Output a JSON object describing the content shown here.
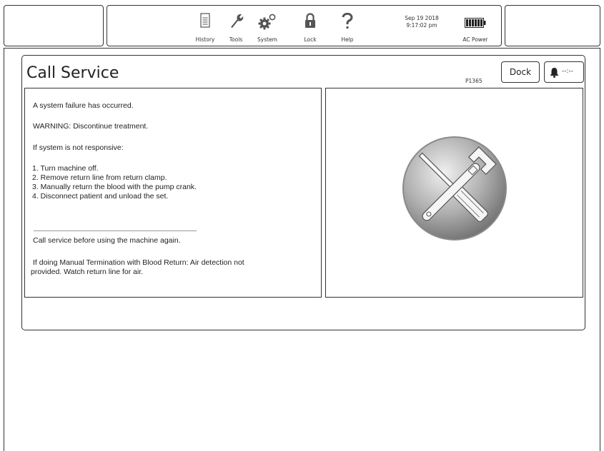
{
  "topbar": {
    "nav": [
      {
        "label": "History",
        "icon": "document-icon"
      },
      {
        "label": "Tools",
        "icon": "wrench-icon"
      },
      {
        "label": "System",
        "icon": "gears-icon"
      },
      {
        "label": "Lock",
        "icon": "padlock-icon"
      },
      {
        "label": "Help",
        "icon": "question-icon"
      }
    ],
    "date": "Sep 19 2018",
    "time": "9:17:02 pm",
    "power": "AC Power"
  },
  "panel": {
    "title": "Call Service",
    "code": "P1365",
    "dock_label": "Dock",
    "alarm_time": "--:--",
    "message": {
      "line1": "A system failure has occurred.",
      "line2": "WARNING: Discontinue treatment.",
      "line3": "If system is not responsive:",
      "steps": [
        "1.  Turn machine off.",
        "2.  Remove return line from return clamp.",
        "3.  Manually return the blood with the pump crank.",
        "4.  Disconnect patient and unload the set."
      ],
      "after1": "Call service before using the machine again.",
      "after2a": "If doing Manual Termination with Blood Return: Air detection not",
      "after2b": "provided. Watch return line for air."
    },
    "image_icon": "service-tools-icon"
  }
}
